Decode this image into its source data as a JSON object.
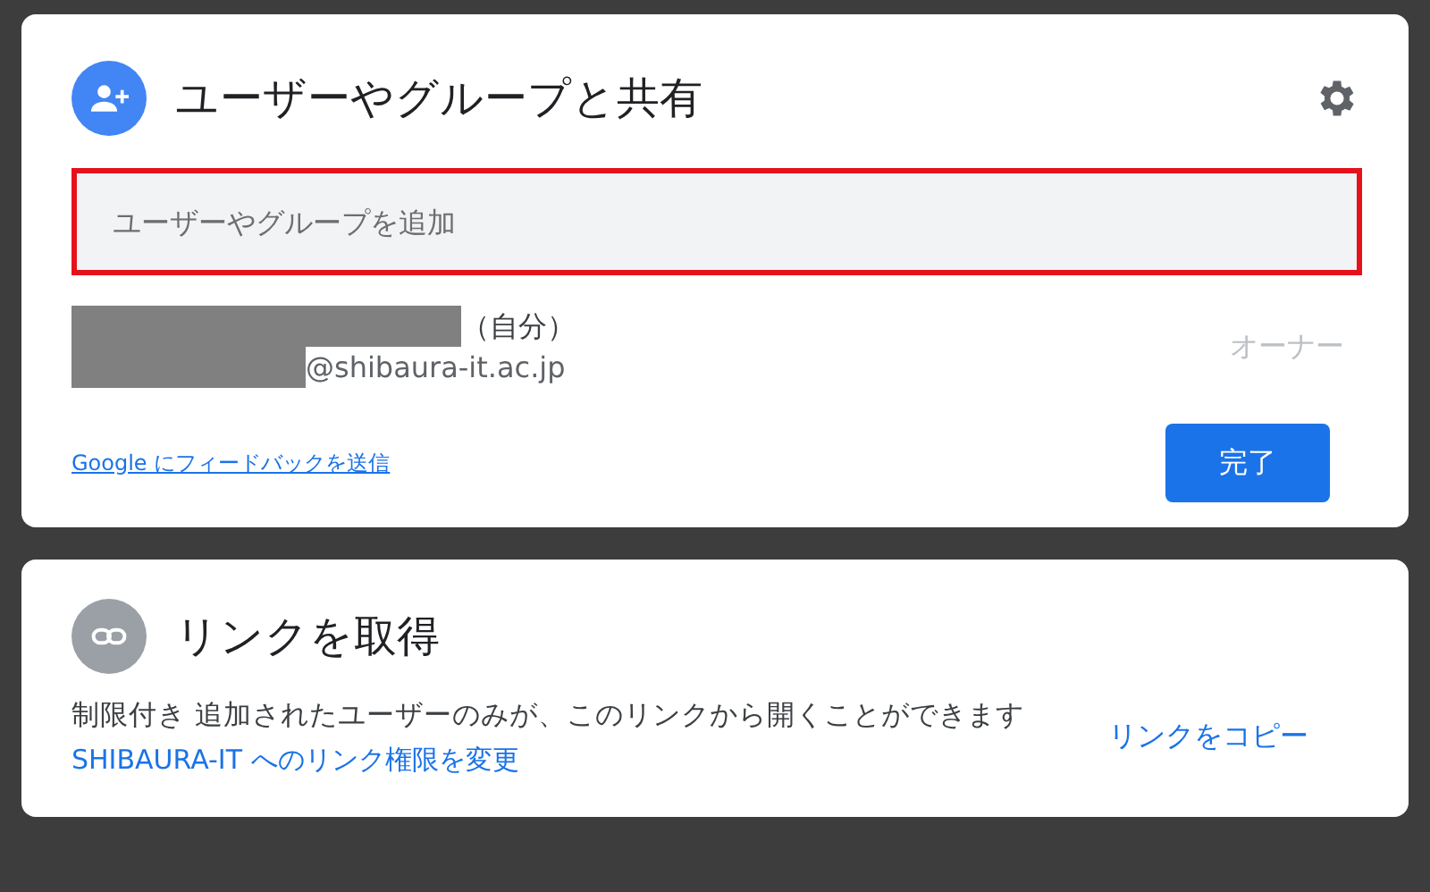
{
  "share": {
    "title": "ユーザーやグループと共有",
    "field": {
      "placeholder": "ユーザーやグループを追加"
    },
    "people": [
      {
        "name_suffix": "（自分）",
        "email": "@shibaura-it.ac.jp",
        "role": "オーナー",
        "redacted": true
      }
    ],
    "feedback_link": "Google にフィードバックを送信",
    "done_button": "完了"
  },
  "link": {
    "title": "リンクを取得",
    "description": "制限付き 追加されたユーザーのみが、このリンクから開くことができます",
    "change_link": "SHIBAURA-IT へのリンク権限を変更",
    "copy_link": "リンクをコピー"
  }
}
